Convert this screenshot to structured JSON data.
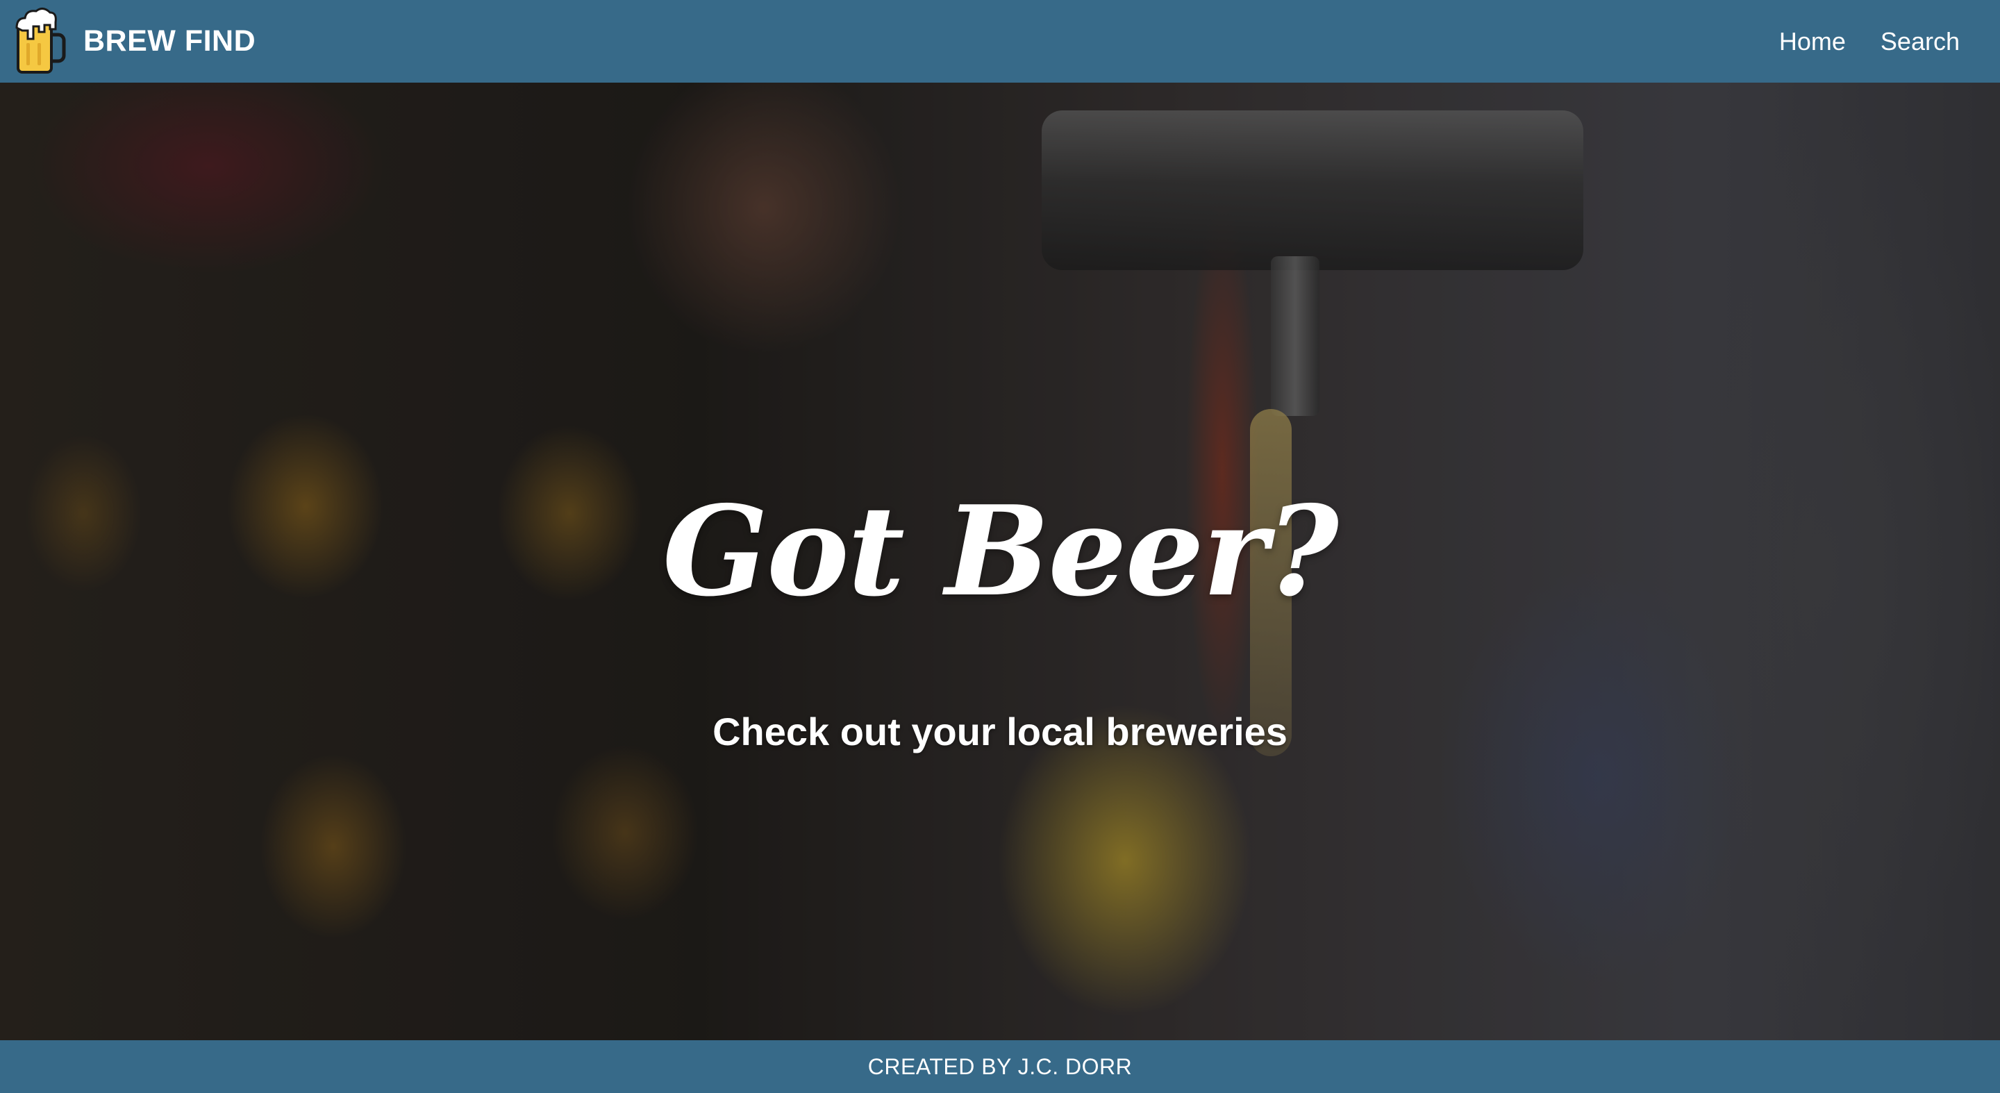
{
  "navbar": {
    "brand_name": "BREW FIND",
    "logo_icon": "beer-mug-icon",
    "links": [
      {
        "label": "Home"
      },
      {
        "label": "Search"
      }
    ]
  },
  "hero": {
    "title": "Got Beer?",
    "subtitle": "Check out your local breweries",
    "background_image": "beer-pouring-from-tap-photo"
  },
  "footer": {
    "credit": "CREATED BY J.C. DORR"
  },
  "colors": {
    "header_footer": "#376a89",
    "text": "#ffffff",
    "logo_beer": "#f5c842"
  }
}
